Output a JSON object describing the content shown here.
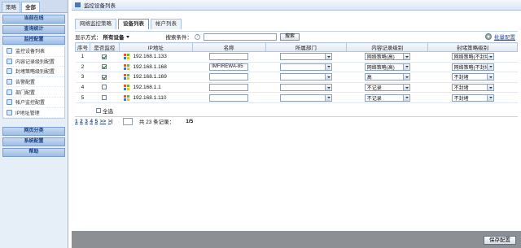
{
  "sidebar": {
    "tabs": [
      "策略",
      "全部"
    ],
    "sections": [
      "当前在线",
      "查询统计",
      "监控配置"
    ],
    "items": [
      "监控设备列表",
      "内容记录级别配置",
      "封堵策略级别配置",
      "告警配置",
      "部门配置",
      "帐户监控配置",
      "IP地址管理"
    ],
    "bottom_sections": [
      "网页分类",
      "系统配置",
      "帮助"
    ]
  },
  "main": {
    "title": "监控设备列表",
    "tabs": [
      "网络监控策略",
      "设备列表",
      "帐户列表"
    ],
    "toolbar": {
      "display_label": "显示方式：",
      "display_value": "所有设备",
      "search_label": "搜索条件：",
      "help": "?",
      "search_value": "",
      "search_button": "搜索",
      "batch_label": "批量配置"
    },
    "columns": [
      "序号",
      "是否监控",
      "IP地址",
      "名称",
      "所属部门",
      "内容记录级别",
      "封堵策略级别"
    ],
    "rows": [
      {
        "no": "1",
        "checked": true,
        "ip": "192.168.1.133",
        "name": "",
        "dept": "",
        "content": "网络策略(高)",
        "block": "网络策略(不封堵)"
      },
      {
        "no": "2",
        "checked": true,
        "ip": "192.168.1.168",
        "name": "IMFIREWA-85",
        "dept": "",
        "content": "网络策略(高)",
        "block": "网络策略(不封堵)"
      },
      {
        "no": "3",
        "checked": true,
        "ip": "192.168.1.169",
        "name": "",
        "dept": "",
        "content": "高",
        "block": "不封堵"
      },
      {
        "no": "4",
        "checked": false,
        "ip": "192.168.1.1",
        "name": "",
        "dept": "",
        "content": "不记录",
        "block": "不封堵"
      },
      {
        "no": "5",
        "checked": false,
        "ip": "192.168.1.110",
        "name": "",
        "dept": "",
        "content": "不记录",
        "block": "不封堵"
      }
    ],
    "select_all_label": "全选",
    "pager": {
      "pages": [
        "1",
        "2",
        "3",
        "4",
        "5",
        ">>",
        ">|"
      ],
      "total": "共 23 条记录：",
      "ratio": "1/5"
    },
    "save_button": "保存配置"
  }
}
